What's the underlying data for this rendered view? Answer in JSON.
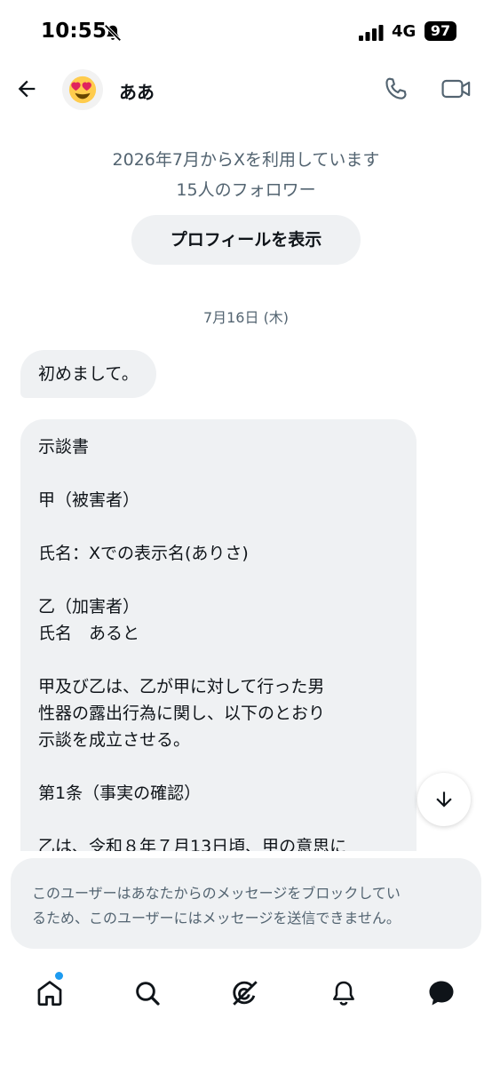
{
  "status_bar": {
    "time": "10:55",
    "network": "4G",
    "battery": "97"
  },
  "header": {
    "name": "ああ",
    "avatar_emoji": "😍"
  },
  "profile": {
    "joined": "2026年7月からXを利用しています",
    "followers": "15人のフォロワー",
    "view_profile_label": "プロフィールを表示"
  },
  "date_separator": "7月16日 (木)",
  "messages": {
    "first": "初めまして。",
    "document_lines": [
      "示談書",
      "",
      "甲（被害者）",
      "",
      "氏名：Xでの表示名(ありさ)",
      "",
      "乙（加害者）",
      "氏名　あると",
      "",
      "甲及び乙は、乙が甲に対して行った男",
      "性器の露出行為に関し、以下のとおり",
      "示談を成立させる。",
      "",
      "第1条（事実の確認）",
      "",
      "乙は、令和８年７月13日頃、甲の意思に"
    ]
  },
  "blocked_notice": {
    "line1": "このユーザーはあなたからのメッセージをブロックしてい",
    "line2": "るため、このユーザーにはメッセージを送信できません。"
  },
  "icons": {
    "back": "arrow-left-icon",
    "call": "phone-icon",
    "video": "video-camera-icon",
    "scroll_down": "arrow-down-icon",
    "home": "home-icon",
    "search": "search-icon",
    "grok": "grok-icon",
    "notifications": "bell-icon",
    "messages": "chat-bubble-icon"
  },
  "colors": {
    "accent": "#1d9bf0",
    "bubble": "#eff1f3",
    "secondary_text": "#536471"
  }
}
